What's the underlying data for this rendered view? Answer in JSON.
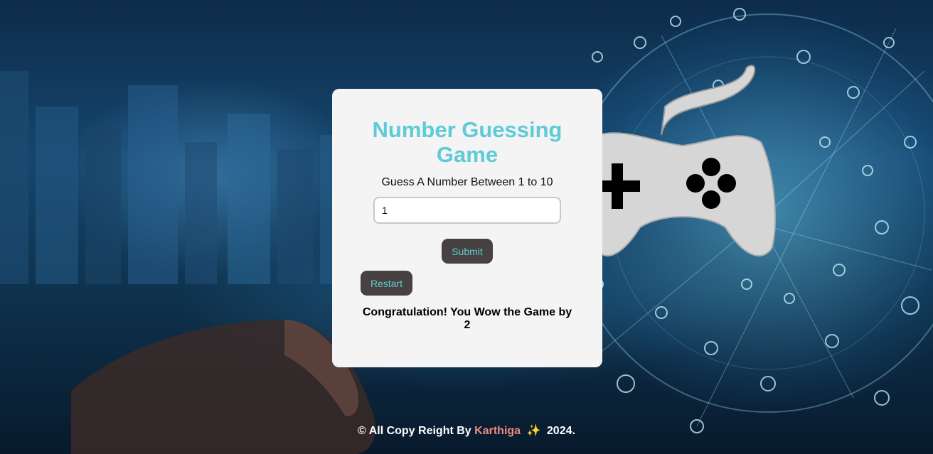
{
  "game": {
    "title": "Number Guessing Game",
    "subtitle": "Guess A Number Between 1 to 10",
    "input_value": "1",
    "submit_label": "Submit",
    "restart_label": "Restart",
    "result_message": "Congratulation! You Wow the Game by 2"
  },
  "footer": {
    "prefix": "© All Copy Reight By",
    "author": "Karthiga",
    "sparkle_icon": "✨",
    "year": "2024."
  },
  "colors": {
    "accent": "#5ecbd8",
    "button_bg": "#474241",
    "card_bg": "#f4f4f4",
    "author": "#f08a80"
  },
  "background": {
    "icon": "gamepad-icon"
  }
}
